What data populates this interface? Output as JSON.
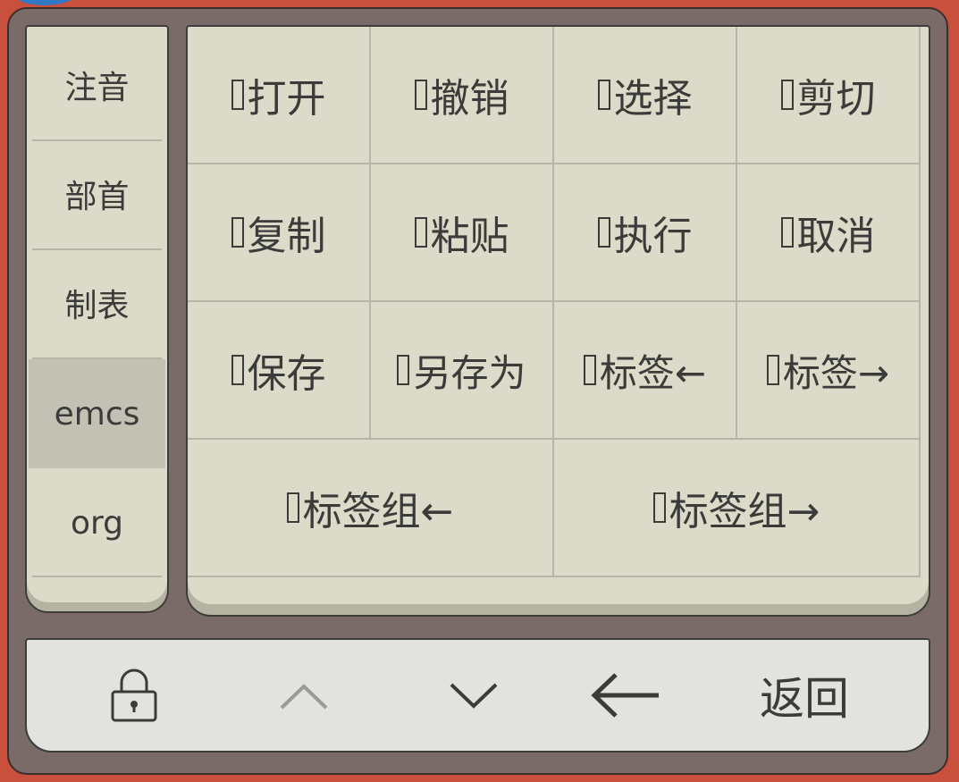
{
  "side_panel": {
    "items": [
      {
        "label": "注音",
        "active": false
      },
      {
        "label": "部首",
        "active": false
      },
      {
        "label": "制表",
        "active": false
      },
      {
        "label": "emcs",
        "active": true
      },
      {
        "label": "org",
        "active": false
      }
    ]
  },
  "keys": {
    "row1": [
      {
        "label": "打开"
      },
      {
        "label": "撤销"
      },
      {
        "label": "选择"
      },
      {
        "label": "剪切"
      }
    ],
    "row2": [
      {
        "label": "复制"
      },
      {
        "label": "粘贴"
      },
      {
        "label": "执行"
      },
      {
        "label": "取消"
      }
    ],
    "row3": [
      {
        "label": "保存"
      },
      {
        "label": "另存为"
      },
      {
        "label": "标签←"
      },
      {
        "label": "标签→"
      }
    ],
    "row4": [
      {
        "label": "标签组←"
      },
      {
        "label": "标签组→"
      }
    ]
  },
  "bottom_bar": {
    "lock_icon": "lock-icon",
    "up_icon": "chevron-up-icon",
    "down_icon": "chevron-down-icon",
    "backspace_icon": "arrow-left-icon",
    "return_label": "返回"
  },
  "colors": {
    "frame": "#7a6b68",
    "outer": "#c8503c",
    "key_face": "#dcdac8",
    "active_item": "#c3c1b4",
    "bar": "#e2e2e0",
    "text": "#3b3b39",
    "disabled_icon": "#9a9a98"
  }
}
